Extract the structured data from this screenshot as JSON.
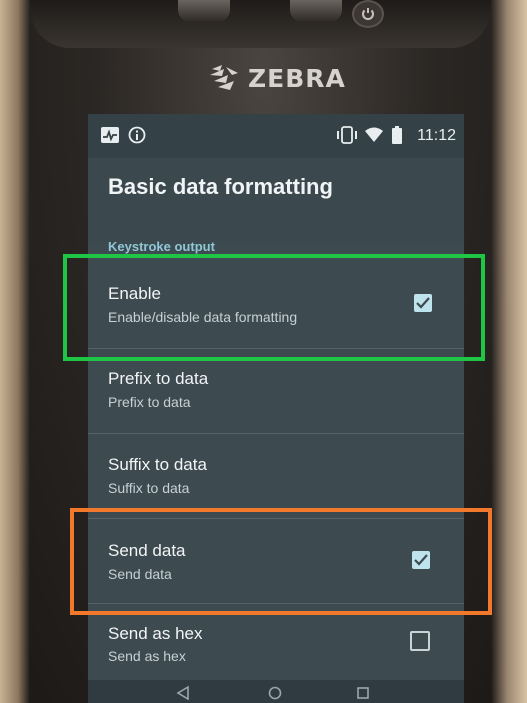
{
  "device": {
    "brand": "ZEBRA"
  },
  "status_bar": {
    "time": "11:12",
    "left_icons": [
      "pulse-icon",
      "info-icon"
    ],
    "right_icons": [
      "vibrate-icon",
      "wifi-icon",
      "battery-icon"
    ]
  },
  "screen": {
    "title": "Basic data formatting",
    "category": "Keystroke output",
    "preferences": [
      {
        "title": "Enable",
        "summary": "Enable/disable data formatting",
        "checkbox": "checked"
      },
      {
        "title": "Prefix to data",
        "summary": "Prefix to data",
        "checkbox": "none"
      },
      {
        "title": "Suffix to data",
        "summary": "Suffix to data",
        "checkbox": "none"
      },
      {
        "title": "Send data",
        "summary": "Send data",
        "checkbox": "checked"
      },
      {
        "title": "Send as hex",
        "summary": "Send as hex",
        "checkbox": "unchecked"
      }
    ]
  },
  "annotations": {
    "highlight_colors": [
      "#1fc545",
      "#f2782c"
    ]
  }
}
